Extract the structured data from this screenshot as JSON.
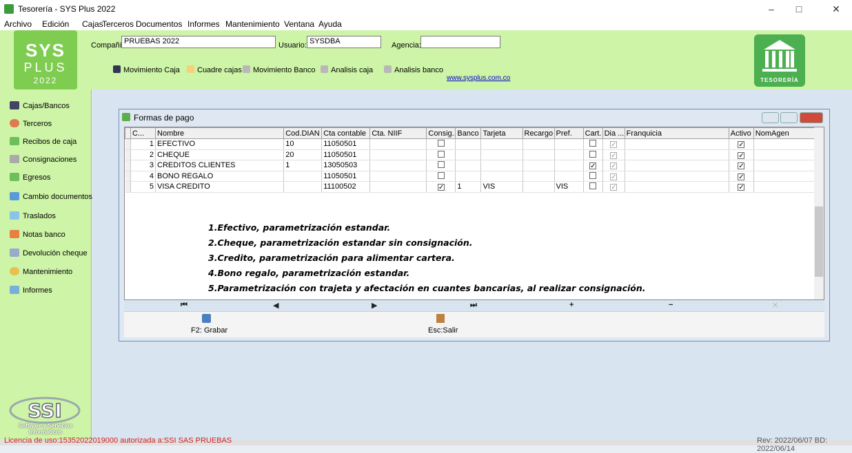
{
  "window": {
    "title": "Tesorería - SYS Plus 2022",
    "controls": [
      "–",
      "□",
      "✕"
    ]
  },
  "menu": [
    "Archivo",
    "Edición",
    "Cajas",
    "Terceros",
    "Documentos",
    "Informes",
    "Mantenimiento",
    "Ventana",
    "Ayuda"
  ],
  "header": {
    "logo": {
      "line1": "SYS",
      "line2": "PLUS",
      "year": "2022"
    },
    "compania_label": "Compañía:",
    "compania_value": "PRUEBAS 2022",
    "usuario_label": "Usuario:",
    "usuario_value": "SYSDBA",
    "agencia_label": "Agencia:",
    "agencia_value": "",
    "toolbar": [
      "Movimiento Caja",
      "Cuadre cajas",
      "Movimiento Banco",
      "Analisis caja",
      "Analisis banco"
    ],
    "website": "www.sysplus.com.co",
    "badge": "TESORERÍA"
  },
  "sidebar": {
    "items": [
      "Cajas/Bancos",
      "Terceros",
      "Recibos de caja",
      "Consignaciones",
      "Egresos",
      "Cambio documentos",
      "Traslados",
      "Notas banco",
      "Devolución cheque",
      "Mantenimiento",
      "Informes"
    ],
    "company_logo": "SSI",
    "company_text": "Software y Servicios Informáticos"
  },
  "child_window": {
    "title": "Formas de pago",
    "columns": [
      "C...",
      "Nombre",
      "Cod.DIAN",
      "Cta contable",
      "Cta. NIIF",
      "Consig...",
      "Banco",
      "Tarjeta",
      "Recargo",
      "Pref.",
      "Cart.",
      "Dia ...",
      "Franquicia",
      "Activo",
      "NomAgen"
    ],
    "rows": [
      {
        "c": "1",
        "nombre": "EFECTIVO",
        "dian": "10",
        "cta": "11050501",
        "niif": "",
        "consig": false,
        "banco": "",
        "tarjeta": "",
        "recargo": "",
        "pref": "",
        "cart": false,
        "dia": true,
        "franq": "",
        "activo": true,
        "nomagen": ""
      },
      {
        "c": "2",
        "nombre": "CHEQUE",
        "dian": "20",
        "cta": "11050501",
        "niif": "",
        "consig": false,
        "banco": "",
        "tarjeta": "",
        "recargo": "",
        "pref": "",
        "cart": false,
        "dia": true,
        "franq": "",
        "activo": true,
        "nomagen": ""
      },
      {
        "c": "3",
        "nombre": "CREDITOS CLIENTES",
        "dian": "1",
        "cta": "13050503",
        "niif": "",
        "consig": false,
        "banco": "",
        "tarjeta": "",
        "recargo": "",
        "pref": "",
        "cart": true,
        "dia": true,
        "franq": "",
        "activo": true,
        "nomagen": ""
      },
      {
        "c": "4",
        "nombre": "BONO REGALO",
        "dian": "",
        "cta": "11050501",
        "niif": "",
        "consig": false,
        "banco": "",
        "tarjeta": "",
        "recargo": "",
        "pref": "",
        "cart": false,
        "dia": true,
        "franq": "",
        "activo": true,
        "nomagen": ""
      },
      {
        "c": "5",
        "nombre": "VISA CREDITO",
        "dian": "",
        "cta": "11100502",
        "niif": "",
        "consig": true,
        "banco": "1",
        "tarjeta": "VIS",
        "recargo": "",
        "pref": "VIS",
        "cart": false,
        "dia": true,
        "franq": "",
        "activo": true,
        "nomagen": ""
      }
    ],
    "notes": [
      "1.Efectivo, parametrización estandar.",
      "2.Cheque, parametrización estandar sin consignación.",
      "3.Credito, parametrización para alimentar cartera.",
      "4.Bono regalo, parametrización estandar.",
      "5.Parametrización con trajeta y afectación en cuantes bancarias, al realizar consignación."
    ],
    "nav": [
      "⏮",
      "◀",
      "▶",
      "⏭",
      "+",
      "−",
      "✕"
    ],
    "buttons": {
      "save": "F2: Grabar",
      "exit": "Esc:Salir"
    }
  },
  "status": {
    "license": "Licencia de uso:15352022019000 autorizada a:SSI SAS PRUEBAS",
    "revision": "Rev: 2022/06/07 BD: 2022/06/14"
  },
  "colors": {
    "green_header": "#cdf4a7",
    "logo_green": "#7fcd50",
    "license_red": "#d02020",
    "link_blue": "#0000cc"
  }
}
